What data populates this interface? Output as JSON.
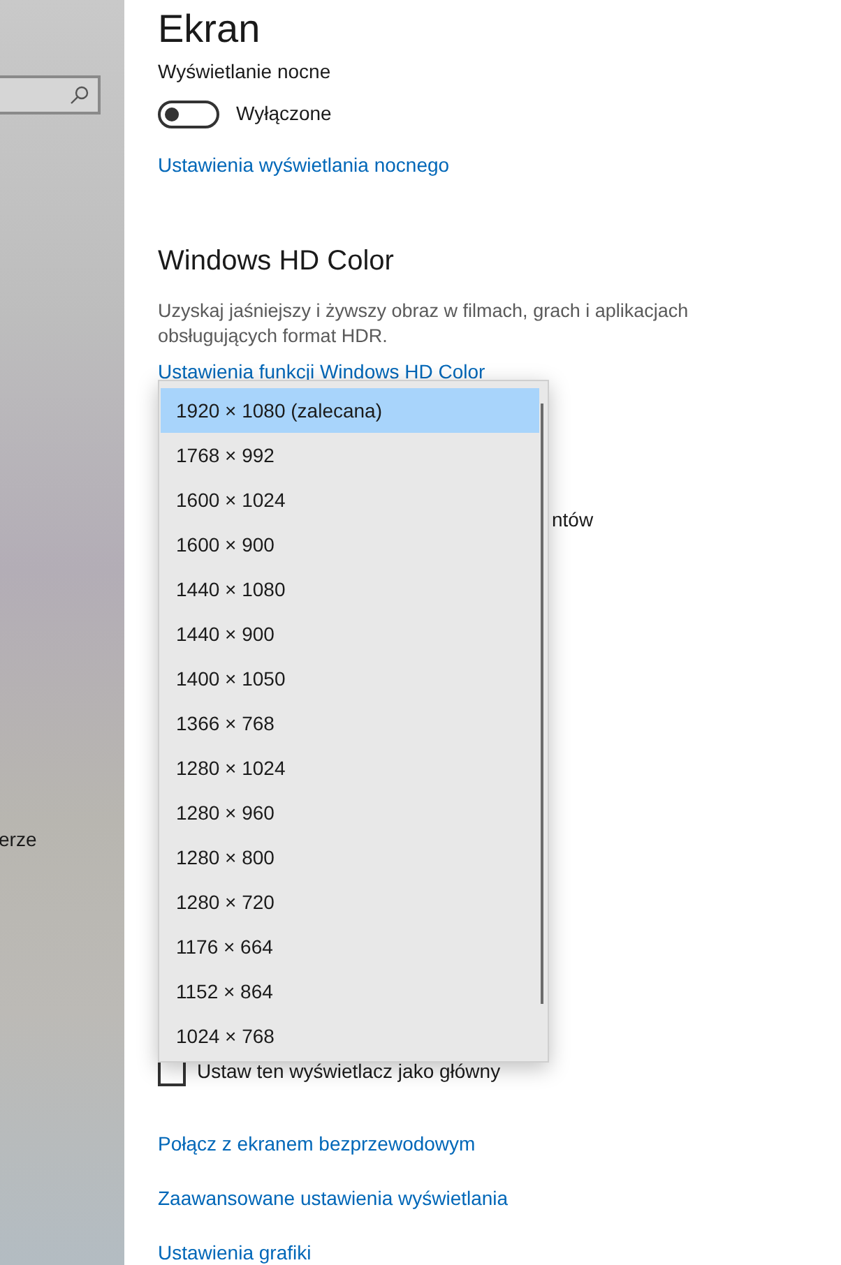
{
  "sidebar": {
    "partial_label": "erze"
  },
  "title": "Ekran",
  "night_light": {
    "label": "Wyświetlanie nocne",
    "on": false,
    "state_text": "Wyłączone",
    "link": "Ustawienia wyświetlania nocnego"
  },
  "hd_color": {
    "heading": "Windows HD Color",
    "description": "Uzyskaj jaśniejszy i żywszy obraz w filmach, grach i aplikacjach obsługujących format HDR.",
    "link": "Ustawienia funkcji Windows HD Color"
  },
  "covered_text": "ntów",
  "resolution_dropdown": {
    "items": [
      {
        "label": "1920 × 1080 (zalecana)",
        "selected": true
      },
      {
        "label": "1768 × 992",
        "selected": false
      },
      {
        "label": "1600 × 1024",
        "selected": false
      },
      {
        "label": "1600 × 900",
        "selected": false
      },
      {
        "label": "1440 × 1080",
        "selected": false
      },
      {
        "label": "1440 × 900",
        "selected": false
      },
      {
        "label": "1400 × 1050",
        "selected": false
      },
      {
        "label": "1366 × 768",
        "selected": false
      },
      {
        "label": "1280 × 1024",
        "selected": false
      },
      {
        "label": "1280 × 960",
        "selected": false
      },
      {
        "label": "1280 × 800",
        "selected": false
      },
      {
        "label": "1280 × 720",
        "selected": false
      },
      {
        "label": "1176 × 664",
        "selected": false
      },
      {
        "label": "1152 × 864",
        "selected": false
      },
      {
        "label": "1024 × 768",
        "selected": false
      }
    ]
  },
  "main_display": {
    "label": "Ustaw ten wyświetlacz jako główny",
    "checked": false
  },
  "links": [
    "Połącz z ekranem bezprzewodowym",
    "Zaawansowane ustawienia wyświetlania",
    "Ustawienia grafiki"
  ]
}
